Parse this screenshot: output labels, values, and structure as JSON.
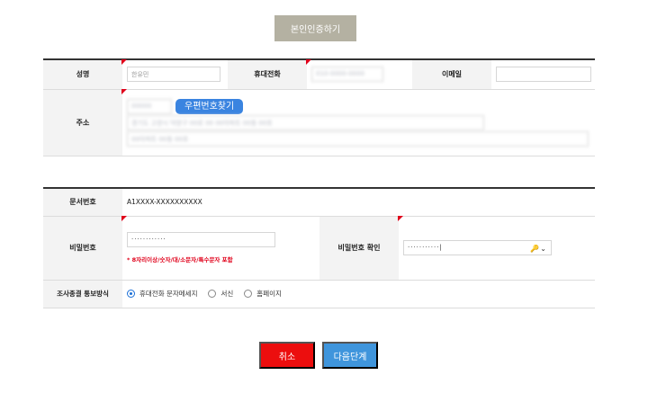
{
  "verify_button": "본인인증하기",
  "applicant": {
    "name_label": "성명",
    "name_value": "한유민",
    "phone_label": "휴대전화",
    "phone_value": "010-0000-0000",
    "email_label": "이메일",
    "email_value": ""
  },
  "address": {
    "label": "주소",
    "zip_value": "00000",
    "zip_button": "우편번호찾기",
    "line1_value": "경기도 고양시 덕양구 00로 00 00아파트 00동 00호",
    "line2_value": "00아파트 00동 00호"
  },
  "document": {
    "number_label": "문서번호",
    "number_value": "A1XXXX-XXXXXXXXXX",
    "password_label": "비밀번호",
    "password_value": "············",
    "password_hint": "* 8자리이상/숫자/대/소문자/특수문자 포함",
    "password_confirm_label": "비밀번호 확인",
    "password_confirm_value": "···········",
    "password_confirm_caret": "|",
    "key_icon": "🔑⌄"
  },
  "notify": {
    "label": "조사종결 통보방식",
    "options": [
      "휴대전화 문자메세지",
      "서신",
      "홈페이지"
    ],
    "selected": "휴대전화 문자메세지"
  },
  "footer": {
    "cancel": "취소",
    "next": "다음단계"
  },
  "colors": {
    "required_marker": "#e0001a",
    "zip_button": "#3a84e0",
    "cancel": "#ec0e0e",
    "next": "#3f95dc",
    "verify": "#b4b1a2"
  }
}
